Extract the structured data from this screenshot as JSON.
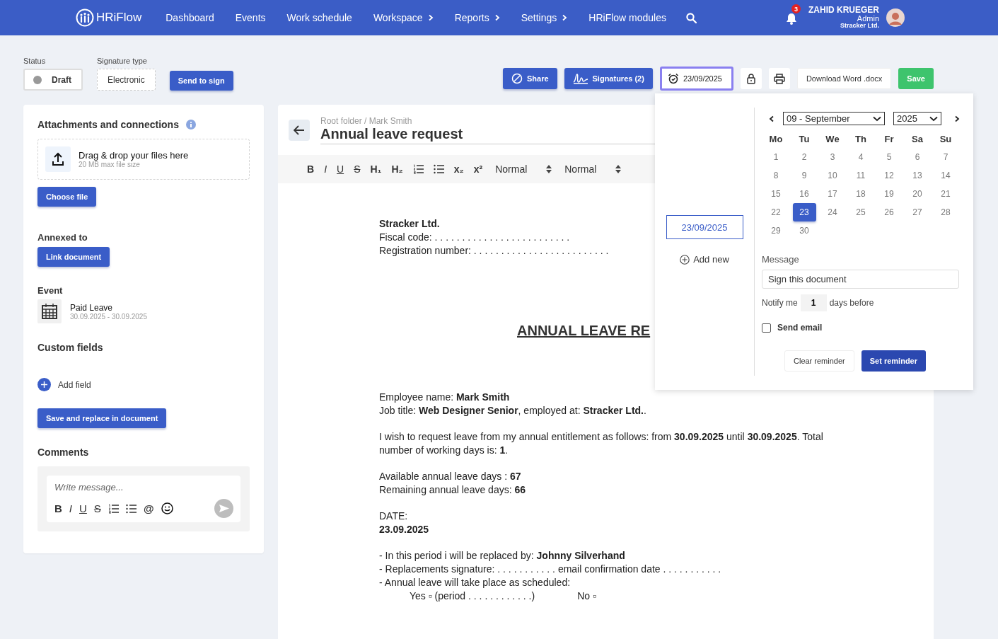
{
  "header": {
    "logo": "HRiFlow",
    "nav": [
      {
        "label": "Dashboard",
        "has_menu": false
      },
      {
        "label": "Events",
        "has_menu": false
      },
      {
        "label": "Work schedule",
        "has_menu": false
      },
      {
        "label": "Workspace",
        "has_menu": true
      },
      {
        "label": "Reports",
        "has_menu": true
      },
      {
        "label": "Settings",
        "has_menu": true
      },
      {
        "label": "HRiFlow modules",
        "has_menu": false
      }
    ],
    "notifications": "3",
    "user": {
      "name": "ZAHID KRUEGER",
      "role": "Admin",
      "company": "Stracker Ltd."
    }
  },
  "controls": {
    "status_label": "Status",
    "status": "Draft",
    "signature_label": "Signature type",
    "signature_type": "Electronic",
    "send_to_sign": "Send to sign",
    "share": "Share",
    "signatures": "Signatures (2)",
    "reminder_date": "23/09/2025",
    "download": "Download Word .docx",
    "save": "Save"
  },
  "left_panel": {
    "attachments_title": "Attachments and connections",
    "dropzone_title": "Drag & drop your files here",
    "dropzone_hint": "20 MB max file size",
    "choose_file": "Choose file",
    "annexed_title": "Annexed to",
    "link_document": "Link document",
    "event_title": "Event",
    "event_name": "Paid Leave",
    "event_dates": "30.09.2025 - 30.09.2025",
    "custom_fields_title": "Custom fields",
    "add_field": "Add field",
    "save_replace": "Save and replace in document",
    "comments_title": "Comments",
    "comment_placeholder": "Write message...",
    "comment_tools": [
      {
        "kind": "bold",
        "label": "B"
      },
      {
        "kind": "italic",
        "label": "I"
      },
      {
        "kind": "underline",
        "label": "U"
      },
      {
        "kind": "strike",
        "label": "S"
      },
      {
        "kind": "ol"
      },
      {
        "kind": "ul"
      },
      {
        "kind": "plain",
        "label": "@"
      },
      {
        "kind": "emoji"
      }
    ]
  },
  "document": {
    "breadcrumb": "Root folder / Mark Smith",
    "title": "Annual leave request",
    "toolbar": [
      {
        "kind": "bold",
        "label": "B"
      },
      {
        "kind": "italic",
        "label": "I"
      },
      {
        "kind": "underline",
        "label": "U"
      },
      {
        "kind": "strike",
        "label": "S"
      },
      {
        "kind": "bold",
        "label": "H₁"
      },
      {
        "kind": "bold",
        "label": "H₂"
      },
      {
        "kind": "ol"
      },
      {
        "kind": "ul"
      },
      {
        "kind": "bold",
        "label": "x₂"
      },
      {
        "kind": "bold",
        "label": "x²"
      }
    ],
    "selects": [
      "Normal",
      "Normal"
    ],
    "blocks": [
      {
        "kind": "lines",
        "lines": [
          {
            "kind": "strong",
            "text": "Stracker Ltd."
          },
          {
            "kind": "text",
            "text": "Fiscal code:  . . . . . . . . . . . . . . . . . . . . . . . . ."
          },
          {
            "kind": "text",
            "text": "Registration number:  . . . . . . . . . . . . . . . . . . . . . . . . ."
          }
        ]
      },
      {
        "kind": "title",
        "text": "ANNUAL LEAVE RE"
      },
      {
        "kind": "lines",
        "lines": [
          {
            "kind": "text",
            "text": "Employee name: **Mark Smith**"
          },
          {
            "kind": "text",
            "text": "Job title: **Web Designer Senior**, employed at: **Stracker Ltd.**."
          }
        ]
      },
      {
        "kind": "lines",
        "lines": [
          {
            "kind": "text",
            "text": "I wish to request leave from my annual entitlement as follows: from **30.09.2025**  until **30.09.2025**. Total number of working days is: **1**."
          }
        ]
      },
      {
        "kind": "lines",
        "lines": [
          {
            "kind": "text",
            "text": "Available annual leave days : **67**"
          },
          {
            "kind": "text",
            "text": "Remaining annual leave days: **66**"
          }
        ]
      },
      {
        "kind": "lines",
        "lines": [
          {
            "kind": "text",
            "text": "DATE:"
          },
          {
            "kind": "strong",
            "text": "23.09.2025"
          }
        ]
      },
      {
        "kind": "lines",
        "lines": [
          {
            "kind": "text",
            "text": "- In this period i will be replaced by: **Johnny Silverhand**"
          },
          {
            "kind": "text",
            "text": "- Replacements signature: . . . . . . . . . . . email confirmation date . . . . . . . . . . ."
          },
          {
            "kind": "text",
            "text": "- Annual leave will take place as scheduled:"
          }
        ],
        "options": [
          "Yes ▫ (period . . . . . . . . . . . .)",
          "No ▫"
        ]
      }
    ]
  },
  "reminder_popup": {
    "dates": [
      {
        "label": "23/09/2025",
        "selected": true
      }
    ],
    "add_new": "Add new",
    "month": "09 - September",
    "year": "2025",
    "weekdays": [
      "Mo",
      "Tu",
      "We",
      "Th",
      "Fr",
      "Sa",
      "Su"
    ],
    "days": [
      {
        "label": "1",
        "selected": false
      },
      {
        "label": "2",
        "selected": false
      },
      {
        "label": "3",
        "selected": false
      },
      {
        "label": "4",
        "selected": false
      },
      {
        "label": "5",
        "selected": false
      },
      {
        "label": "6",
        "selected": false
      },
      {
        "label": "7",
        "selected": false
      },
      {
        "label": "8",
        "selected": false
      },
      {
        "label": "9",
        "selected": false
      },
      {
        "label": "10",
        "selected": false
      },
      {
        "label": "11",
        "selected": false
      },
      {
        "label": "12",
        "selected": false
      },
      {
        "label": "13",
        "selected": false
      },
      {
        "label": "14",
        "selected": false
      },
      {
        "label": "15",
        "selected": false
      },
      {
        "label": "16",
        "selected": false
      },
      {
        "label": "17",
        "selected": false
      },
      {
        "label": "18",
        "selected": false
      },
      {
        "label": "19",
        "selected": false
      },
      {
        "label": "20",
        "selected": false
      },
      {
        "label": "21",
        "selected": false
      },
      {
        "label": "22",
        "selected": false
      },
      {
        "label": "23",
        "selected": true
      },
      {
        "label": "24",
        "selected": false
      },
      {
        "label": "25",
        "selected": false
      },
      {
        "label": "26",
        "selected": false
      },
      {
        "label": "27",
        "selected": false
      },
      {
        "label": "28",
        "selected": false
      },
      {
        "label": "29",
        "selected": false
      },
      {
        "label": "30",
        "selected": false
      }
    ],
    "message_label": "Message",
    "message": "Sign this document",
    "notify_label": "Notify me",
    "notify_days": "1",
    "notify_suffix": "days before",
    "send_email": {
      "label": "Send email",
      "checked": false
    },
    "clear": "Clear reminder",
    "set": "Set reminder"
  }
}
